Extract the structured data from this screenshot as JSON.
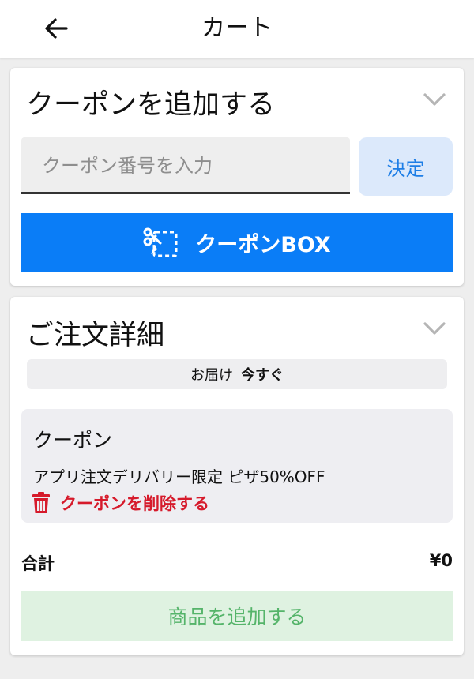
{
  "header": {
    "title": "カート",
    "back_icon": "arrow-left-icon"
  },
  "coupon_card": {
    "title": "クーポンを追加する",
    "chevron_icon": "chevron-down-icon",
    "input_placeholder": "クーポン番号を入力",
    "input_value": "",
    "decide_label": "決定",
    "coupon_box_label": "クーポンBOX",
    "coupon_box_icon": "scissors-coupon-icon"
  },
  "order_card": {
    "title": "ご注文詳細",
    "chevron_icon": "chevron-down-icon",
    "delivery_label": "お届け",
    "delivery_time": "今すぐ",
    "coupon_section": {
      "title": "クーポン",
      "coupon_name": "アプリ注文デリバリー限定 ピザ50%OFF",
      "remove_label": "クーポンを削除する",
      "remove_icon": "trash-icon"
    },
    "total_label": "合計",
    "total_value": "¥0",
    "add_items_label": "商品を追加する"
  },
  "colors": {
    "primary_blue": "#0a7df7",
    "decide_bg": "#dce9fb",
    "decide_text": "#1e7ee6",
    "danger_red": "#d61a2b",
    "add_bg": "#dff2e1",
    "add_text": "#55b46a"
  }
}
